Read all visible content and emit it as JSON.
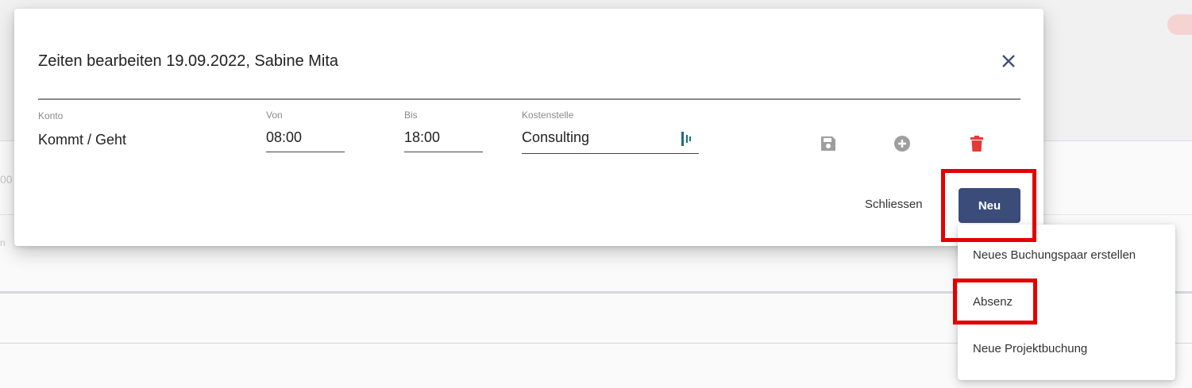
{
  "background": {
    "fragment_1": "00",
    "fragment_2": "n"
  },
  "dialog": {
    "title": "Zeiten bearbeiten 19.09.2022, Sabine Mita",
    "close_icon": "close-icon",
    "fields": {
      "konto": {
        "label": "Konto",
        "value": "Kommt / Geht"
      },
      "von": {
        "label": "Von",
        "value": "08:00"
      },
      "bis": {
        "label": "Bis",
        "value": "18:00"
      },
      "kostenstelle": {
        "label": "Kostenstelle",
        "value": "Consulting",
        "icon": "selector-icon"
      }
    },
    "actions": [
      {
        "name": "save",
        "icon": "floppy-disk-icon",
        "color": "#9e9e9e"
      },
      {
        "name": "add",
        "icon": "plus-circle-icon",
        "color": "#9e9e9e"
      },
      {
        "name": "delete",
        "icon": "trash-icon",
        "color": "#e53935"
      }
    ],
    "close_label": "Schliessen",
    "new_label": "Neu"
  },
  "menu": {
    "items": [
      {
        "label": "Neues Buchungspaar erstellen"
      },
      {
        "label": "Absenz"
      },
      {
        "label": "Neue Projektbuchung"
      }
    ]
  },
  "colors": {
    "primary": "#3b4c7a",
    "danger": "#e53935",
    "highlight": "#e30000"
  }
}
